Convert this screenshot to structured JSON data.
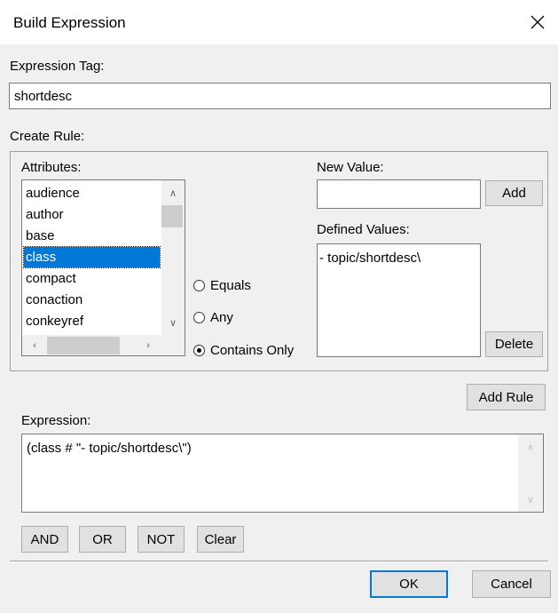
{
  "window": {
    "title": "Build Expression"
  },
  "expression_tag": {
    "label": "Expression Tag:",
    "value": "shortdesc"
  },
  "create_rule": {
    "label": "Create Rule:",
    "attributes": {
      "label": "Attributes:",
      "items": [
        "audience",
        "author",
        "base",
        "class",
        "compact",
        "conaction",
        "conkeyref"
      ],
      "selected": "class"
    },
    "operators": [
      {
        "label": "Equals",
        "checked": false
      },
      {
        "label": "Any",
        "checked": false
      },
      {
        "label": "Contains Only",
        "checked": true
      }
    ],
    "new_value": {
      "label": "New Value:",
      "value": "",
      "add_label": "Add"
    },
    "defined_values": {
      "label": "Defined Values:",
      "items": [
        "- topic/shortdesc\\"
      ],
      "delete_label": "Delete"
    }
  },
  "add_rule_label": "Add Rule",
  "expression": {
    "label": "Expression:",
    "value": "(class # \"- topic/shortdesc\\\")"
  },
  "logic_buttons": [
    "AND",
    "OR",
    "NOT",
    "Clear"
  ],
  "footer": {
    "ok_label": "OK",
    "cancel_label": "Cancel"
  }
}
